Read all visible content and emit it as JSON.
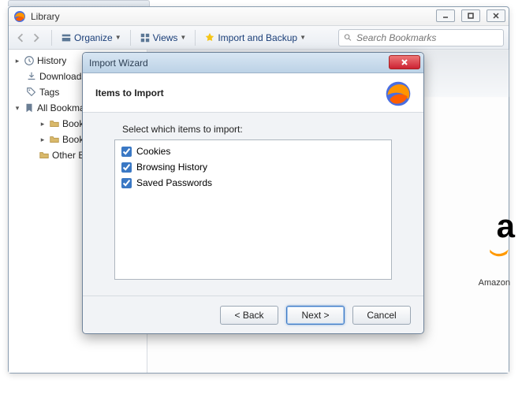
{
  "library": {
    "title": "Library",
    "toolbar": {
      "organize": "Organize",
      "views": "Views",
      "import_backup": "Import and Backup",
      "search_placeholder": "Search Bookmarks"
    },
    "tree": {
      "history": "History",
      "downloads": "Downloads",
      "tags": "Tags",
      "all_bookmarks": "All Bookmarks",
      "bookmarks_toolbar": "Bookmarks Toolbar",
      "bookmarks_menu": "Bookmarks Menu",
      "other_bookmarks": "Other Bookmarks"
    },
    "content_hint": "Amazon"
  },
  "dialog": {
    "window_title": "Import Wizard",
    "header_title": "Items to Import",
    "instruction": "Select which items to import:",
    "items": {
      "cookies": "Cookies",
      "history": "Browsing History",
      "passwords": "Saved Passwords"
    },
    "buttons": {
      "back": "< Back",
      "next": "Next >",
      "cancel": "Cancel"
    }
  }
}
